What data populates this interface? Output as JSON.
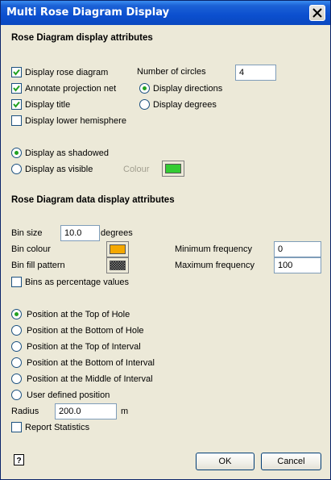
{
  "window": {
    "title": "Multi Rose Diagram Display"
  },
  "section1": {
    "heading": "Rose Diagram display attributes",
    "display_rose_diagram": {
      "label": "Display rose diagram",
      "checked": true
    },
    "annotate_projection_net": {
      "label": "Annotate projection net",
      "checked": true
    },
    "display_title": {
      "label": "Display title",
      "checked": true
    },
    "display_lower_hemisphere": {
      "label": "Display lower hemisphere",
      "checked": false
    },
    "number_of_circles_label": "Number of circles",
    "number_of_circles_value": "4",
    "display_directions": {
      "label": "Display directions",
      "selected": true
    },
    "display_degrees": {
      "label": "Display degrees",
      "selected": false
    },
    "display_as_shadowed": {
      "label": "Display as shadowed",
      "selected": true
    },
    "display_as_visible": {
      "label": "Display as visible",
      "selected": false
    },
    "colour_label": "Colour",
    "colour_value": "#33cc33"
  },
  "section2": {
    "heading": "Rose Diagram data display attributes",
    "bin_size_label": "Bin size",
    "bin_size_value": "10.0",
    "bin_size_unit": "degrees",
    "bin_colour_label": "Bin colour",
    "bin_colour_value": "#f5a800",
    "bin_fill_pattern_label": "Bin fill pattern",
    "minimum_frequency_label": "Minimum frequency",
    "minimum_frequency_value": "0",
    "maximum_frequency_label": "Maximum frequency",
    "maximum_frequency_value": "100",
    "bins_as_percentage": {
      "label": "Bins as percentage values",
      "checked": false
    }
  },
  "position": {
    "options": [
      {
        "label": "Position at the Top of Hole",
        "selected": true
      },
      {
        "label": "Position at the Bottom of Hole",
        "selected": false
      },
      {
        "label": "Position at the Top of Interval",
        "selected": false
      },
      {
        "label": "Position at the Bottom of Interval",
        "selected": false
      },
      {
        "label": "Position at the Middle of Interval",
        "selected": false
      },
      {
        "label": "User defined position",
        "selected": false
      }
    ],
    "radius_label": "Radius",
    "radius_value": "200.0",
    "radius_unit": "m",
    "report_statistics": {
      "label": "Report Statistics",
      "checked": false
    }
  },
  "footer": {
    "help_icon": "help-icon",
    "ok_label": "OK",
    "cancel_label": "Cancel"
  }
}
